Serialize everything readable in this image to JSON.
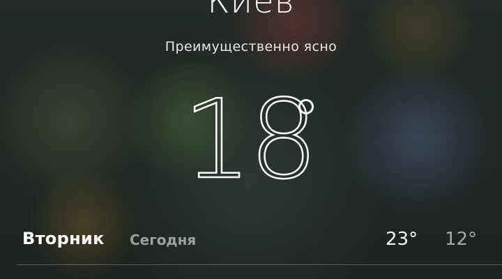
{
  "location": {
    "city": "Киев",
    "condition": "Преимущественно ясно"
  },
  "current": {
    "temperature": "18",
    "degree_symbol": "°"
  },
  "forecast": {
    "day": "Вторник",
    "day_label": "Сегодня",
    "high": "23°",
    "low": "12°"
  },
  "colors": {
    "primary_text": "#ffffff",
    "secondary_text": "#9aa09d",
    "background": "#1d2320"
  }
}
